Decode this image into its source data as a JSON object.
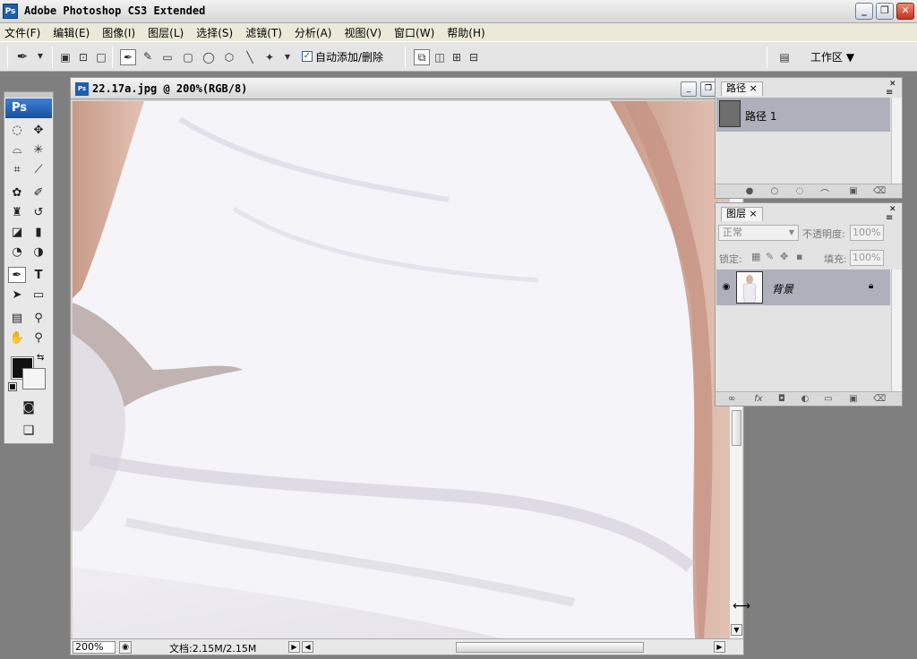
{
  "app": {
    "title": "Adobe Photoshop CS3 Extended",
    "logo": "Ps"
  },
  "window_controls": {
    "minimize": "_",
    "restore": "❐",
    "close": "✕"
  },
  "menubar": {
    "items": [
      {
        "label": "文件(F)"
      },
      {
        "label": "编辑(E)"
      },
      {
        "label": "图像(I)"
      },
      {
        "label": "图层(L)"
      },
      {
        "label": "选择(S)"
      },
      {
        "label": "滤镜(T)"
      },
      {
        "label": "分析(A)"
      },
      {
        "label": "视图(V)"
      },
      {
        "label": "窗口(W)"
      },
      {
        "label": "帮助(H)"
      }
    ]
  },
  "options": {
    "auto_add_delete": "自动添加/删除",
    "auto_checked": "✓",
    "workspace": "工作区 ▼"
  },
  "toolbox": {
    "logo": "Ps",
    "text_tool": "T",
    "swap": "⇆"
  },
  "document": {
    "title": "22.17a.jpg @ 200%(RGB/8)",
    "icon_text": "Ps",
    "zoom": "200%",
    "doc_size": "文档:2.15M/2.15M"
  },
  "paths_panel": {
    "tab": "路径",
    "path_name": "路径 1"
  },
  "layers_panel": {
    "tab": "图层",
    "blend_mode": "正常",
    "opacity_label": "不透明度:",
    "opacity_value": "100%",
    "lock_label": "锁定:",
    "fill_label": "填充:",
    "fill_value": "100%",
    "layer_name": "背景"
  },
  "colors": {
    "foreground": "#111111",
    "background": "#f5f5f5",
    "accent": "#1d5fae"
  }
}
